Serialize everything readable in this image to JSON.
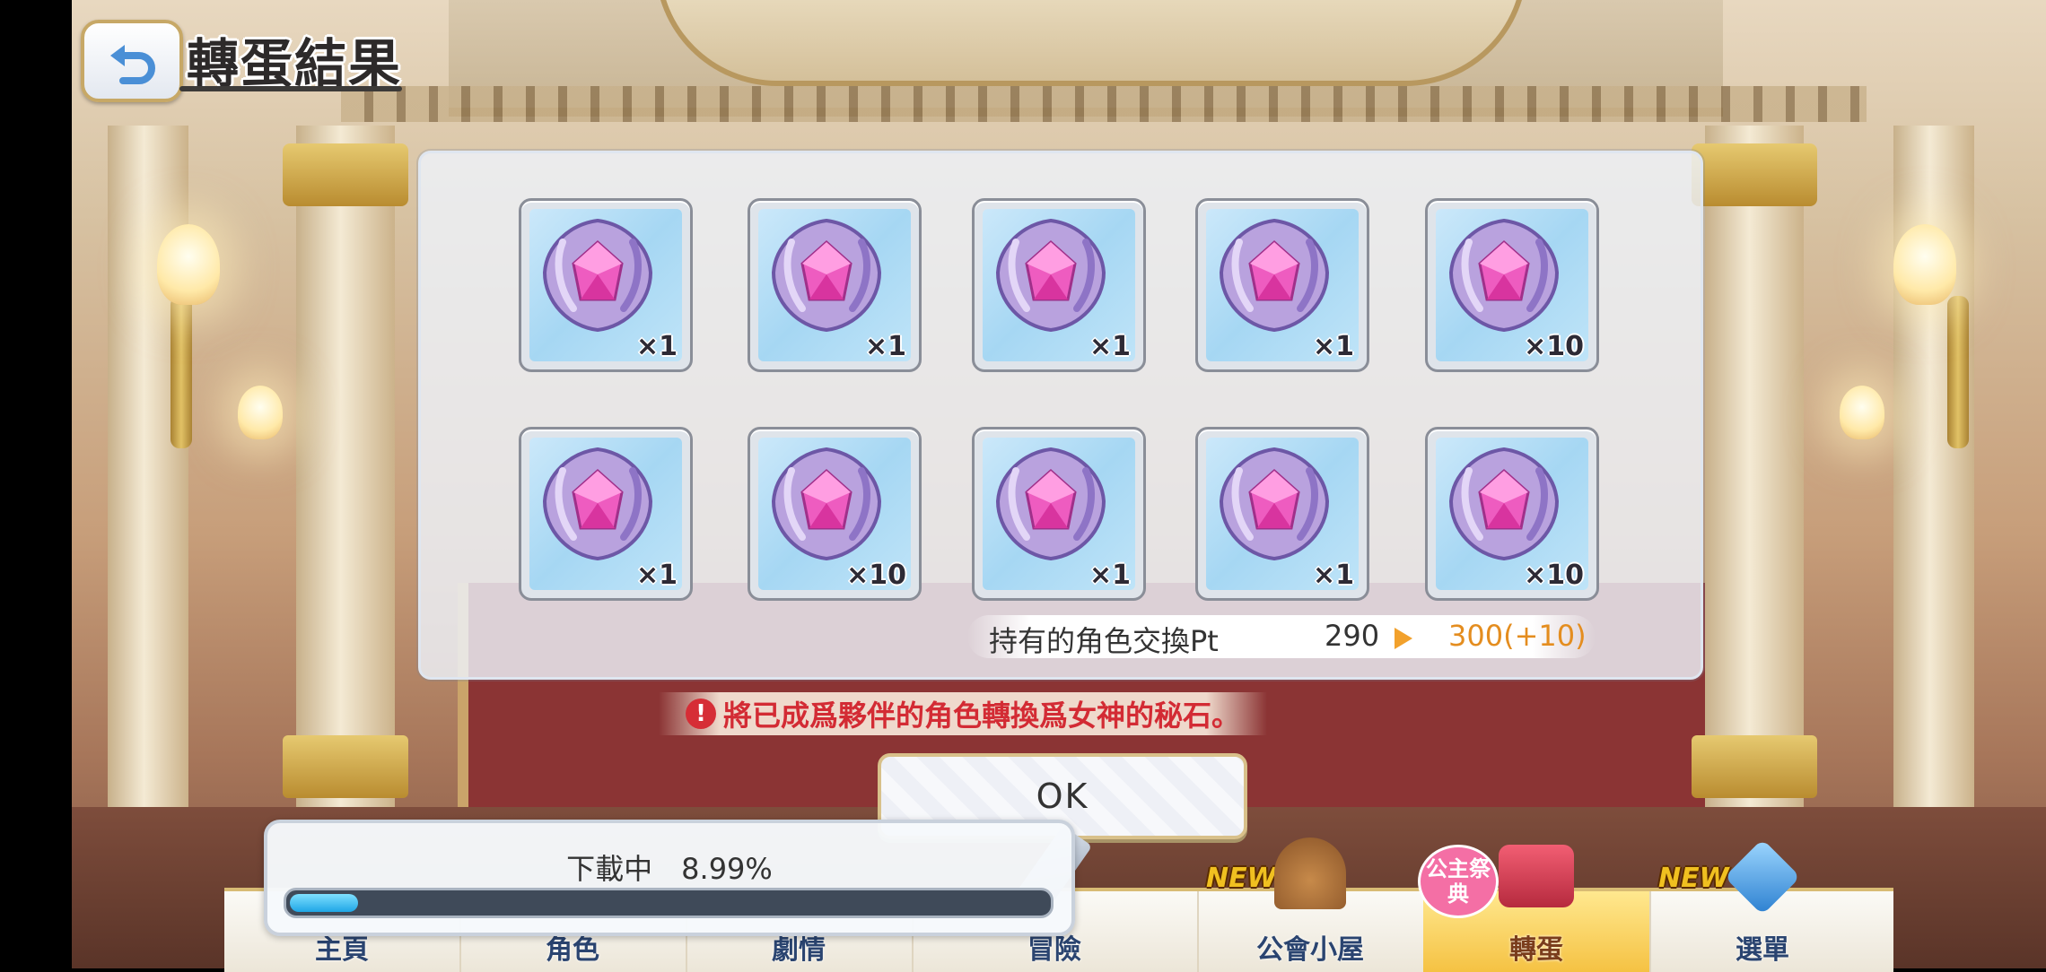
{
  "header": {
    "back_icon": "back-arrow-icon",
    "title": "轉蛋結果"
  },
  "results": {
    "items": [
      {
        "icon": "goddess-stone-icon",
        "qty": "×1"
      },
      {
        "icon": "goddess-stone-icon",
        "qty": "×1"
      },
      {
        "icon": "goddess-stone-icon",
        "qty": "×1"
      },
      {
        "icon": "goddess-stone-icon",
        "qty": "×1"
      },
      {
        "icon": "goddess-stone-icon",
        "qty": "×10"
      },
      {
        "icon": "goddess-stone-icon",
        "qty": "×1"
      },
      {
        "icon": "goddess-stone-icon",
        "qty": "×10"
      },
      {
        "icon": "goddess-stone-icon",
        "qty": "×1"
      },
      {
        "icon": "goddess-stone-icon",
        "qty": "×1"
      },
      {
        "icon": "goddess-stone-icon",
        "qty": "×10"
      }
    ],
    "points": {
      "label": "持有的角色交換Pt",
      "old_value": "290",
      "new_value": "300(+10)"
    }
  },
  "warning": {
    "icon": "!",
    "text": "將已成爲夥伴的角色轉換爲女神的秘石。"
  },
  "ok_button": {
    "label": "OK"
  },
  "download": {
    "text": "下載中　8.99%",
    "progress": 0.0899
  },
  "nav": {
    "items": [
      {
        "label": "主頁",
        "badge": ""
      },
      {
        "label": "角色",
        "badge": ""
      },
      {
        "label": "劇情",
        "badge": ""
      },
      {
        "label": "冒險",
        "badge": ""
      },
      {
        "label": "公會小屋",
        "badge": "NEW"
      },
      {
        "label": "轉蛋",
        "badge": "公主祭典"
      },
      {
        "label": "選單",
        "badge": "NEW"
      }
    ],
    "active": "轉蛋"
  },
  "colors": {
    "accent_gold": "#d8bb74",
    "warning_red": "#d32b34",
    "points_orange": "#e48d1f",
    "progress_blue": "#1fa6e6"
  }
}
